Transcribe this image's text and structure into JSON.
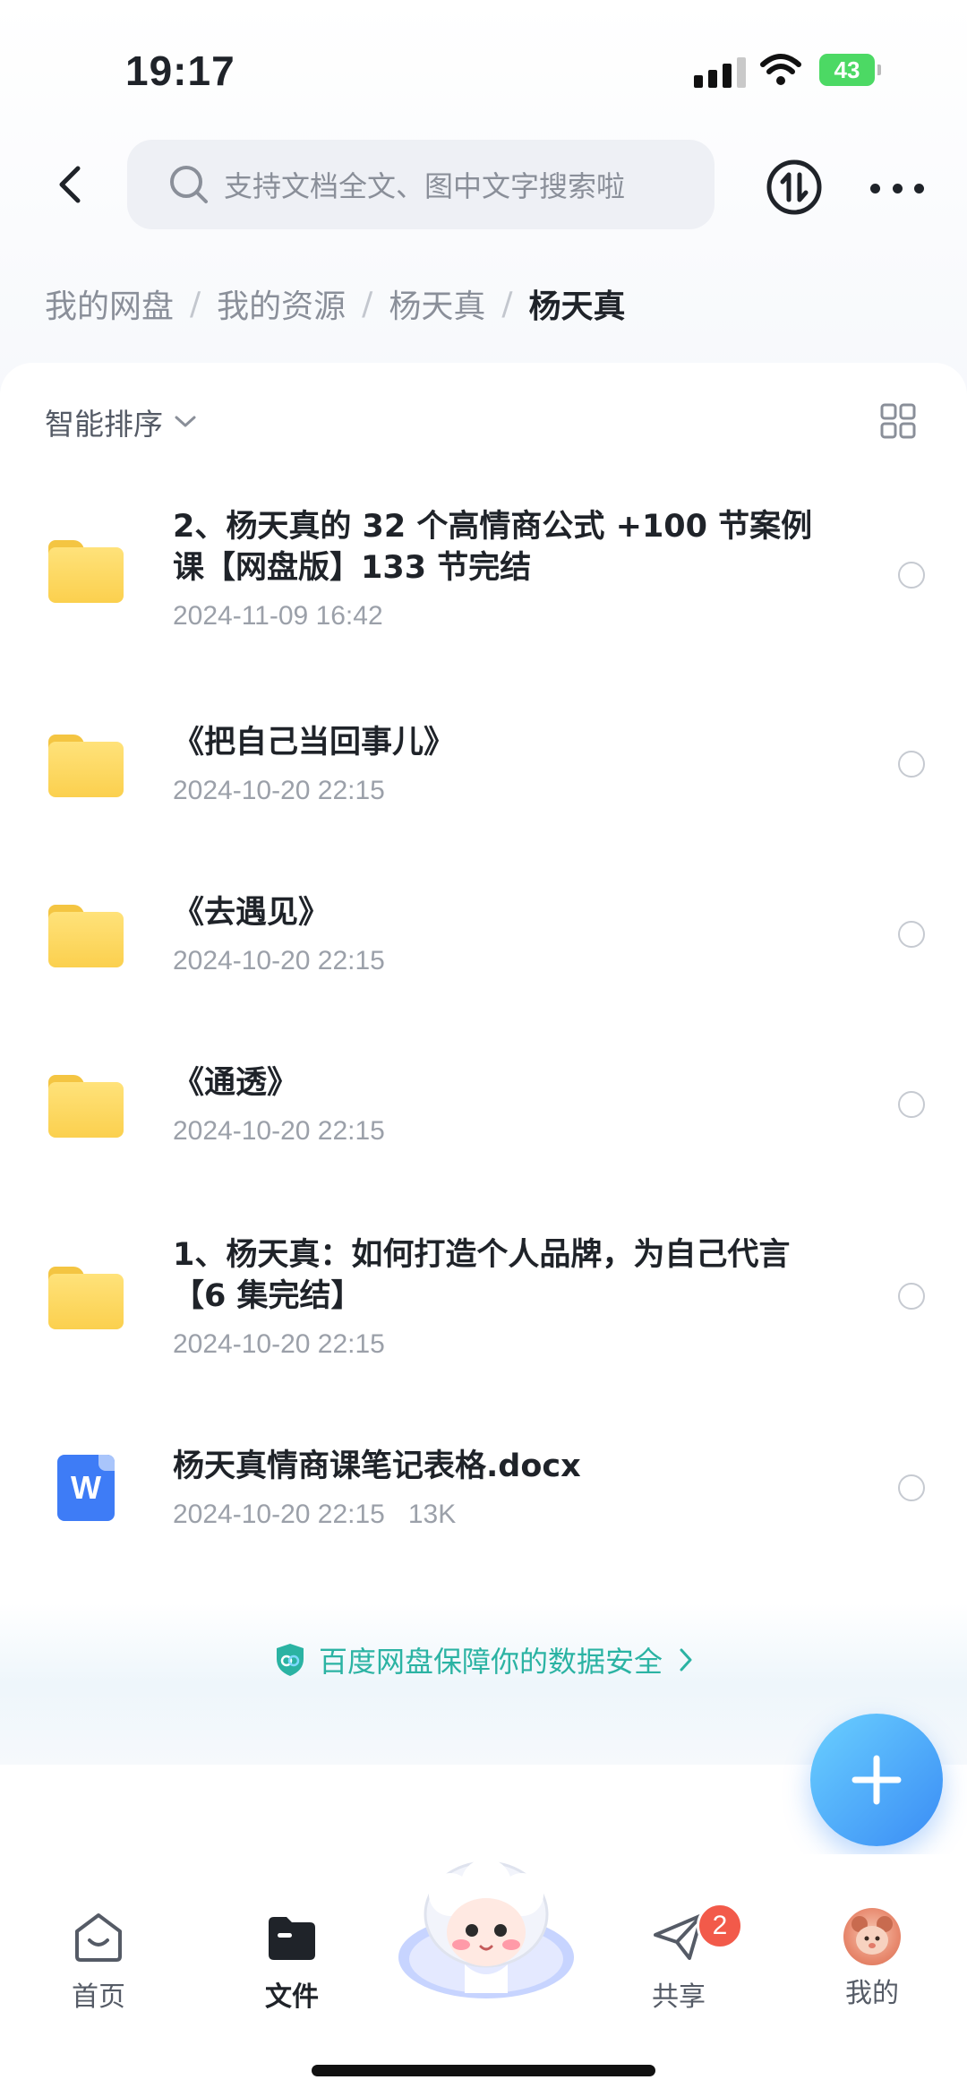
{
  "status_bar": {
    "time": "19:17",
    "battery": "43"
  },
  "header": {
    "search_placeholder": "支持文档全文、图中文字搜索啦"
  },
  "breadcrumb": {
    "items": [
      "我的网盘",
      "我的资源",
      "杨天真"
    ],
    "current": "杨天真",
    "separator": "/"
  },
  "toolbar": {
    "sort_label": "智能排序"
  },
  "files": [
    {
      "type": "folder",
      "name": "2、杨天真的 32 个高情商公式 +100 节案例课【网盘版】133 节完结",
      "date": "2024-11-09 16:42"
    },
    {
      "type": "folder",
      "name": "《把自己当回事儿》",
      "date": "2024-10-20 22:15"
    },
    {
      "type": "folder",
      "name": "《去遇见》",
      "date": "2024-10-20 22:15"
    },
    {
      "type": "folder",
      "name": "《通透》",
      "date": "2024-10-20 22:15"
    },
    {
      "type": "folder",
      "name": "1、杨天真：如何打造个人品牌，为自己代言【6 集完结】",
      "date": "2024-10-20 22:15"
    },
    {
      "type": "docx",
      "icon_letter": "W",
      "name": "杨天真情商课笔记表格.docx",
      "date": "2024-10-20 22:15",
      "size": "13K"
    }
  ],
  "security_banner": {
    "text": "百度网盘保障你的数据安全"
  },
  "tabbar": {
    "home": "首页",
    "files": "文件",
    "share": "共享",
    "share_badge": "2",
    "mine": "我的"
  },
  "colors": {
    "accent": "#3a8cf5",
    "secure_text": "#2bb3a3",
    "folder": "#fbd04e",
    "badge": "#f25a4a"
  }
}
